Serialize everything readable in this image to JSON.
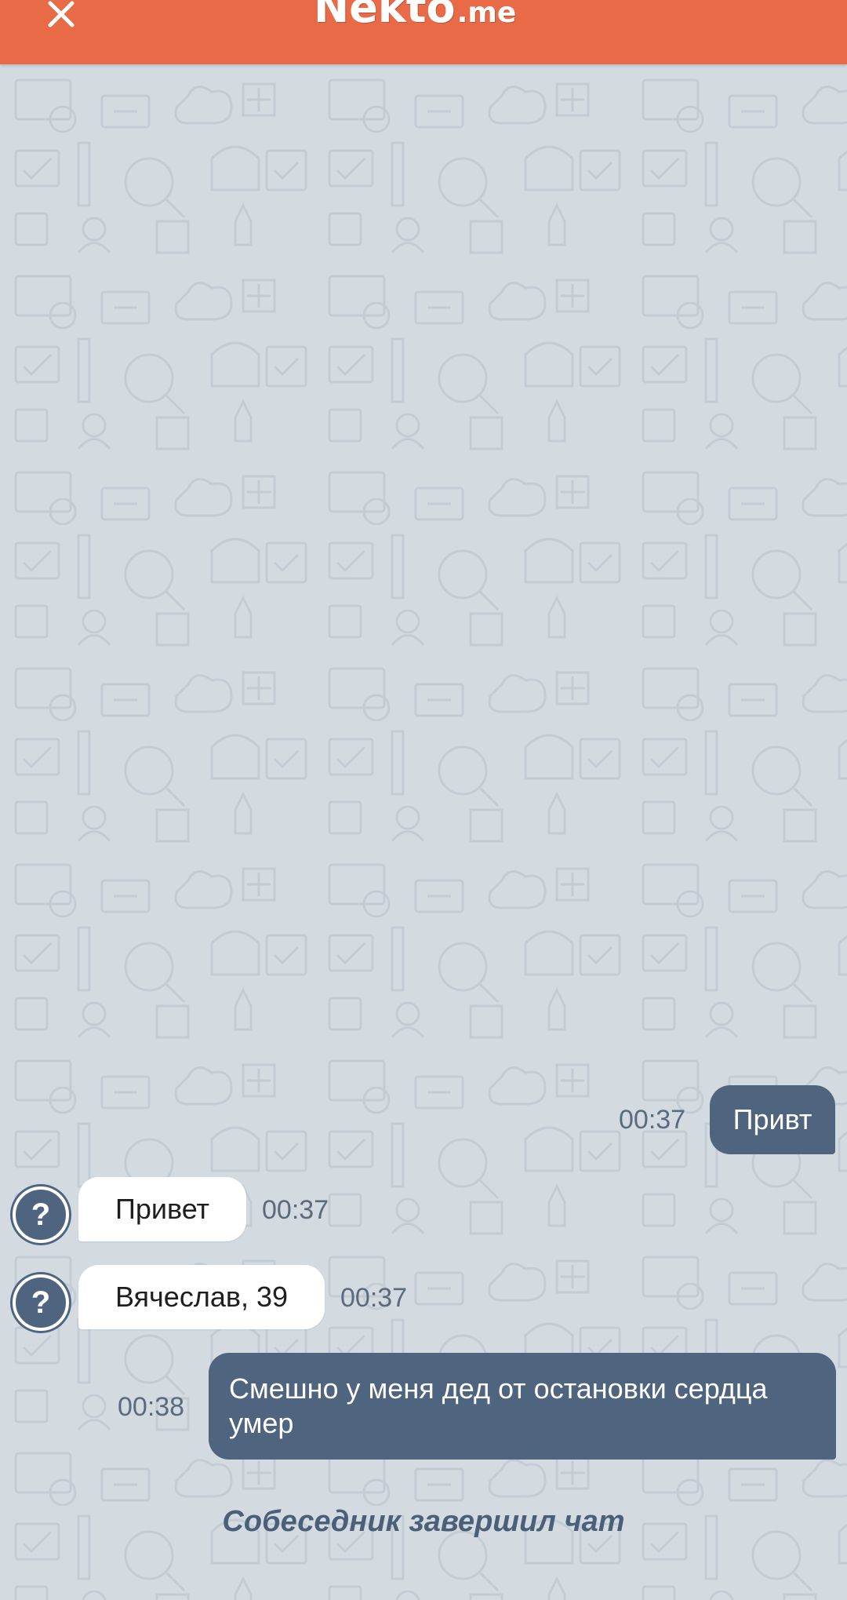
{
  "header": {
    "logo_main": "Nekto",
    "logo_suffix": ".me",
    "close_icon": "close-icon",
    "bg_color": "#e86a47"
  },
  "chat": {
    "messages": [
      {
        "direction": "out",
        "text": "Привт",
        "time": "00:37"
      },
      {
        "direction": "in",
        "avatar": "?",
        "text": "Привет",
        "time": "00:37"
      },
      {
        "direction": "in",
        "avatar": "?",
        "text": "Вячеслав, 39",
        "time": "00:37"
      },
      {
        "direction": "out",
        "text": "Смешно у меня дед от остановки сердца умер",
        "time": "00:38"
      }
    ],
    "system_message": "Собеседник завершил чат",
    "outgoing_color": "#4f647e",
    "incoming_color": "#ffffff"
  }
}
